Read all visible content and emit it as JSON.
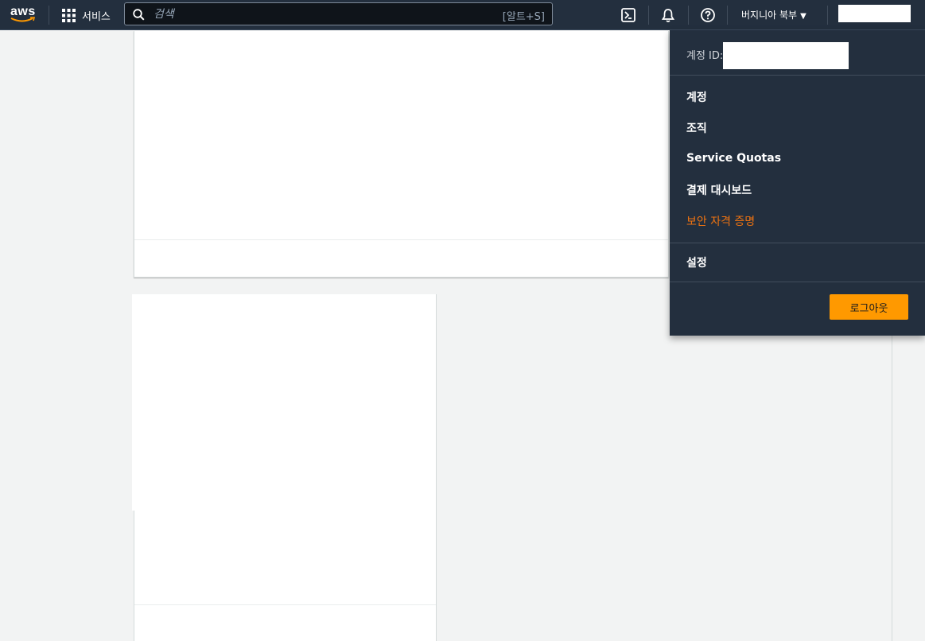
{
  "topnav": {
    "logo_text": "aws",
    "services_label": "서비스",
    "search": {
      "placeholder": "검색",
      "shortcut": "[알트+S]"
    },
    "region_label": "버지니아 북부",
    "icons": [
      "grid-icon",
      "search-icon",
      "cloudshell-icon",
      "bell-icon",
      "help-icon"
    ]
  },
  "account_menu": {
    "id_label": "계정 ID:",
    "items": {
      "account": "계정",
      "organization": "조직",
      "service_quotas": "Service Quotas",
      "billing": "결제 대시보드",
      "security_credentials": "보안 자격 증명",
      "settings": "설정"
    },
    "logout_label": "로그아웃"
  },
  "colors": {
    "nav_bg": "#232f3e",
    "accent_orange": "#ff9900",
    "highlight_text": "#ec7211",
    "page_bg": "#f2f3f3"
  }
}
